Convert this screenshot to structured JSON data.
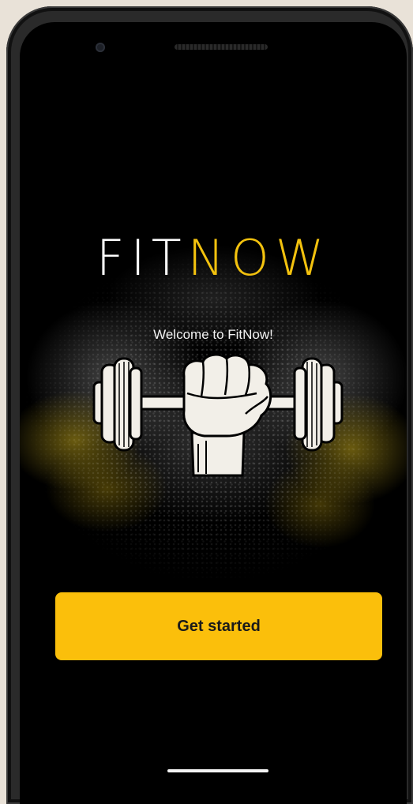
{
  "app": {
    "logo_part1": "FIT",
    "logo_part2": "NOW",
    "welcome_text": "Welcome to FitNow!",
    "emblem_icon": "dumbbell-fist-icon"
  },
  "actions": {
    "get_started_label": "Get started"
  },
  "colors": {
    "accent": "#fbbf0b",
    "logo_highlight": "#f3c20e",
    "background": "#000000"
  }
}
